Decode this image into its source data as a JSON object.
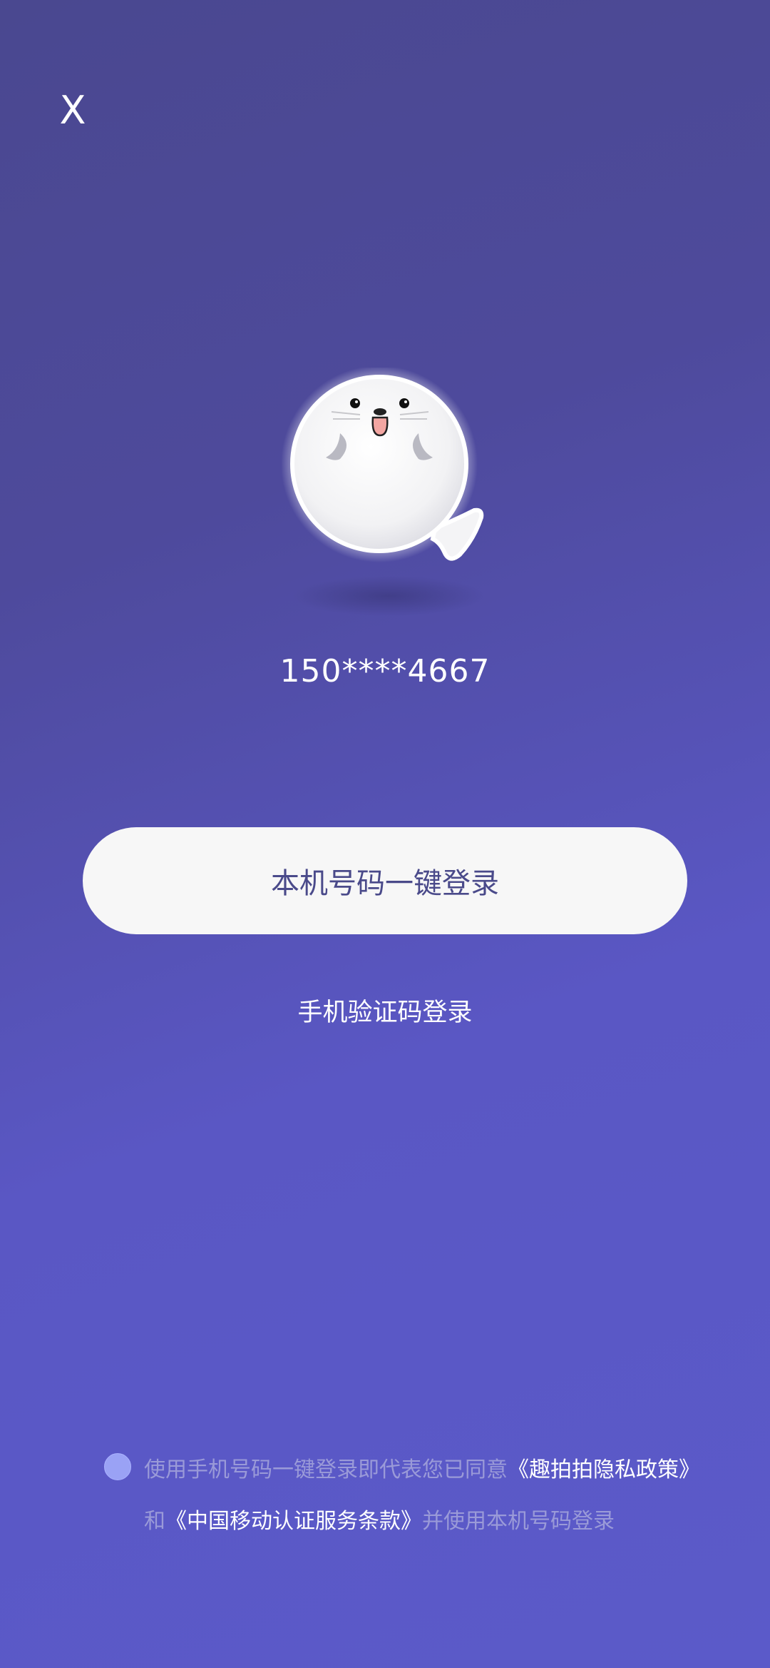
{
  "header": {
    "close_label": "X"
  },
  "mascot": {
    "icon": "seal-mascot-icon"
  },
  "account": {
    "masked_phone": "150****4667"
  },
  "actions": {
    "one_click_login": "本机号码一键登录",
    "sms_login": "手机验证码登录"
  },
  "agreement": {
    "prefix": "使用手机号码一键登录即代表您已同意",
    "privacy_link": "《趣拍拍隐私政策》",
    "and": "和",
    "terms_link": "《中国移动认证服务条款》",
    "suffix": "并使用本机号码登录"
  },
  "colors": {
    "background_top": "#4a4890",
    "background_bottom": "#5b5ac9",
    "button_bg": "#f7f7f7",
    "button_text": "#4a4a8a",
    "radio": "#9aa2f5",
    "muted_text": "#9a9ad8"
  }
}
